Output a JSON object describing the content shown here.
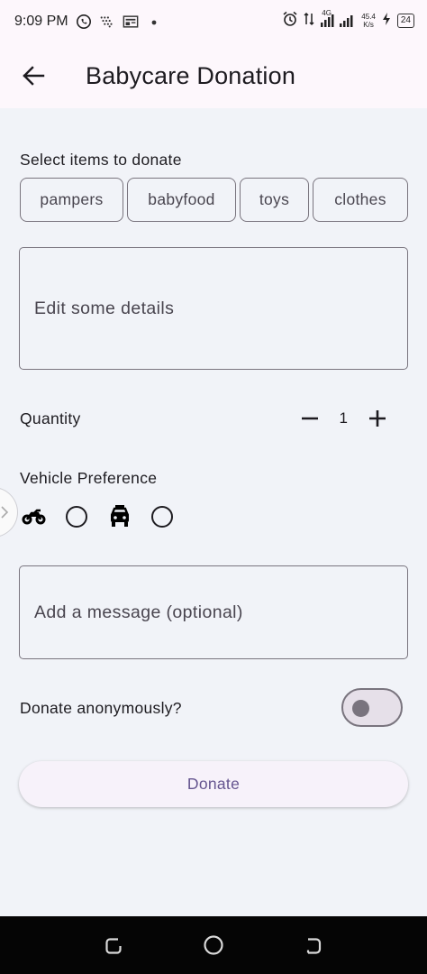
{
  "status_bar": {
    "time": "9:09 PM",
    "net_speed_value": "45.4",
    "net_speed_unit": "K/s",
    "network_type": "4G",
    "battery": "24",
    "icons": [
      "whatsapp-icon",
      "dots-icon",
      "news-icon",
      "dot-icon",
      "alarm-icon",
      "data-icon",
      "signal-icon",
      "charging-icon",
      "battery-icon"
    ]
  },
  "app_bar": {
    "title": "Babycare Donation"
  },
  "items_section": {
    "label": "Select items to donate",
    "chips": [
      "pampers",
      "babyfood",
      "toys",
      "clothes"
    ]
  },
  "details": {
    "placeholder": "Edit some details"
  },
  "quantity": {
    "label": "Quantity",
    "value": "1"
  },
  "vehicle": {
    "label": "Vehicle Preference",
    "options": [
      {
        "icon": "motorcycle-icon",
        "selected": false
      },
      {
        "icon": "car-icon",
        "selected": false
      }
    ]
  },
  "message": {
    "placeholder": "Add a message (optional)"
  },
  "anonymous": {
    "label": "Donate anonymously?",
    "enabled": false
  },
  "donate_button": {
    "label": "Donate"
  },
  "colors": {
    "background": "#f1f3f8",
    "app_bar": "#fdf7fc",
    "accent": "#65558f",
    "outline": "#79747e"
  }
}
